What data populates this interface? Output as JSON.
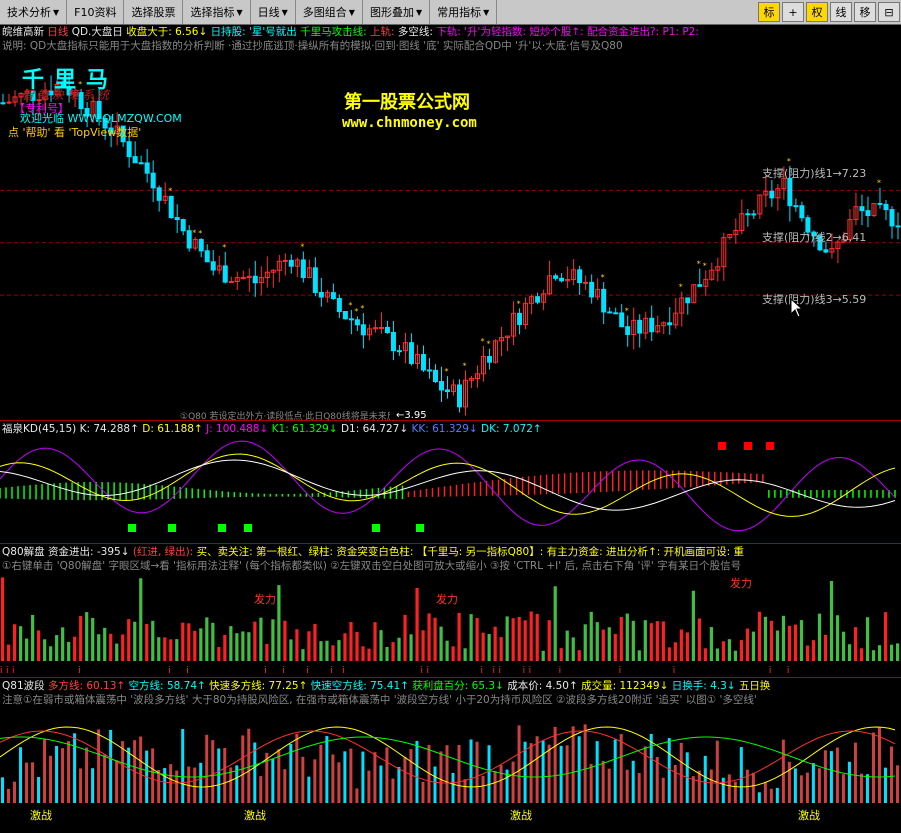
{
  "toolbar": {
    "left": [
      {
        "label": "技术分析",
        "icon": "▼"
      },
      {
        "label": "F10资料",
        "icon": ""
      },
      {
        "label": "选择股票",
        "icon": ""
      },
      {
        "label": "选择指标",
        "icon": "▼"
      },
      {
        "label": "日线",
        "icon": "▼"
      },
      {
        "label": "多图组合",
        "icon": "▼"
      },
      {
        "label": "图形叠加",
        "icon": "▼"
      },
      {
        "label": "常用指标",
        "icon": "▼"
      }
    ],
    "right": [
      {
        "label": "标",
        "active": true
      },
      {
        "label": "+",
        "active": false
      },
      {
        "label": "权",
        "active": true
      },
      {
        "label": "线",
        "active": false
      },
      {
        "label": "移",
        "active": false
      },
      {
        "label": "⊟",
        "active": false
      }
    ]
  },
  "main_header": {
    "stock": "皖维高新",
    "period": "日线",
    "indicator": "QD.大盘日",
    "p1": "收盘大于: 6.56↓",
    "p2": "日持股: '星'号就出",
    "p3": "千里马攻击线:",
    "p4": "上轨:",
    "p5": "多空线:",
    "p6": "下轨: '升'为轻指数: 短炒个股↑: 配合资金进出?: P1: P2:"
  },
  "main_notice": "说明: QD大盘指标只能用于大盘指数的分析判断 ·通过抄底逃顶·操纵所有的模拟·回到·图线 '底' 实际配合QD中 '升'以·大底·信号及Q80",
  "logo": {
    "title": "千里马",
    "subtitle": "智能决策系统",
    "patent": "【专利号】",
    "welcome": "欢迎光临 WWW.QLMZQW.COM",
    "help": "点 '帮助' 看 'TopView数据'"
  },
  "watermark": {
    "title": "第一股票公式网",
    "url": "www.chnmoney.com"
  },
  "support_lines": [
    {
      "label": "支撑(阻力)线1→7.23",
      "value": 7.23
    },
    {
      "label": "支撑(阻力)线2→6.41",
      "value": 6.41
    },
    {
      "label": "支撑(阻力)线3→5.59",
      "value": 5.59
    }
  ],
  "low_label": "←3.95",
  "main_footer_note": "①Q80 若设定出外方·读段低点·此日Q80线将是未来反弹(或上升)的阻力位",
  "kd_header": {
    "name": "福泉KD(45,15)",
    "k": "K: 74.288↑",
    "d": "D: 61.188↑",
    "j": "J: 100.488↓",
    "k1": "K1: 61.329↓",
    "d1": "D1: 64.727↓",
    "kk": "KK: 61.329↓",
    "dk": "DK: 7.072↑"
  },
  "q80_header": {
    "name": "Q80解盘",
    "fund": "资金进出: -395↓",
    "redgreen": "(红进, 绿出):",
    "buy": "买、卖关注: 第一根红、绿柱:",
    "rest": "资金突变白色柱: 【千里马: 另一指标Q80】: 有主力资金: 进出分析↑: 开机画面可设: 重"
  },
  "q80_notice": "①右键单击 'Q80解盘' 字眼区域→看 '指标用法注释' (每个指标都类似) ②左键双击空白处图可放大或缩小 ③按 'CTRL +I' 后, 点击右下角 '评' 字有某日个股信号",
  "q81_header": {
    "name": "Q81波段",
    "duo": "多方线: 60.13↑",
    "kong": "空方线: 58.74↑",
    "kduo": "快速多方线: 77.25↑",
    "kkong": "快速空方线: 75.41↑",
    "profit": "获利盘百分: 65.3↓",
    "cost": "成本价: 4.50↑",
    "vol": "成交量: 112349↓",
    "turn": "日换手: 4.3↓",
    "five": "五日换"
  },
  "q81_notice": "注意①在弱市或箱体震荡中 '波段多方线' 大于80为持股风险区, 在强市或箱体震荡中 '波段空方线' 小于20为持币风险区 ②波段多方线20附近 '追买' 以图① '多空线'",
  "signals": {
    "fa_li": "发力",
    "ji_zhan": "激战"
  },
  "colors": {
    "up": "#ff3030",
    "down": "#00e0ff",
    "kd_purple": "#c000ff",
    "kd_green": "#00ff00",
    "bg": "#000000",
    "toolbar": "#c8c8c8"
  }
}
